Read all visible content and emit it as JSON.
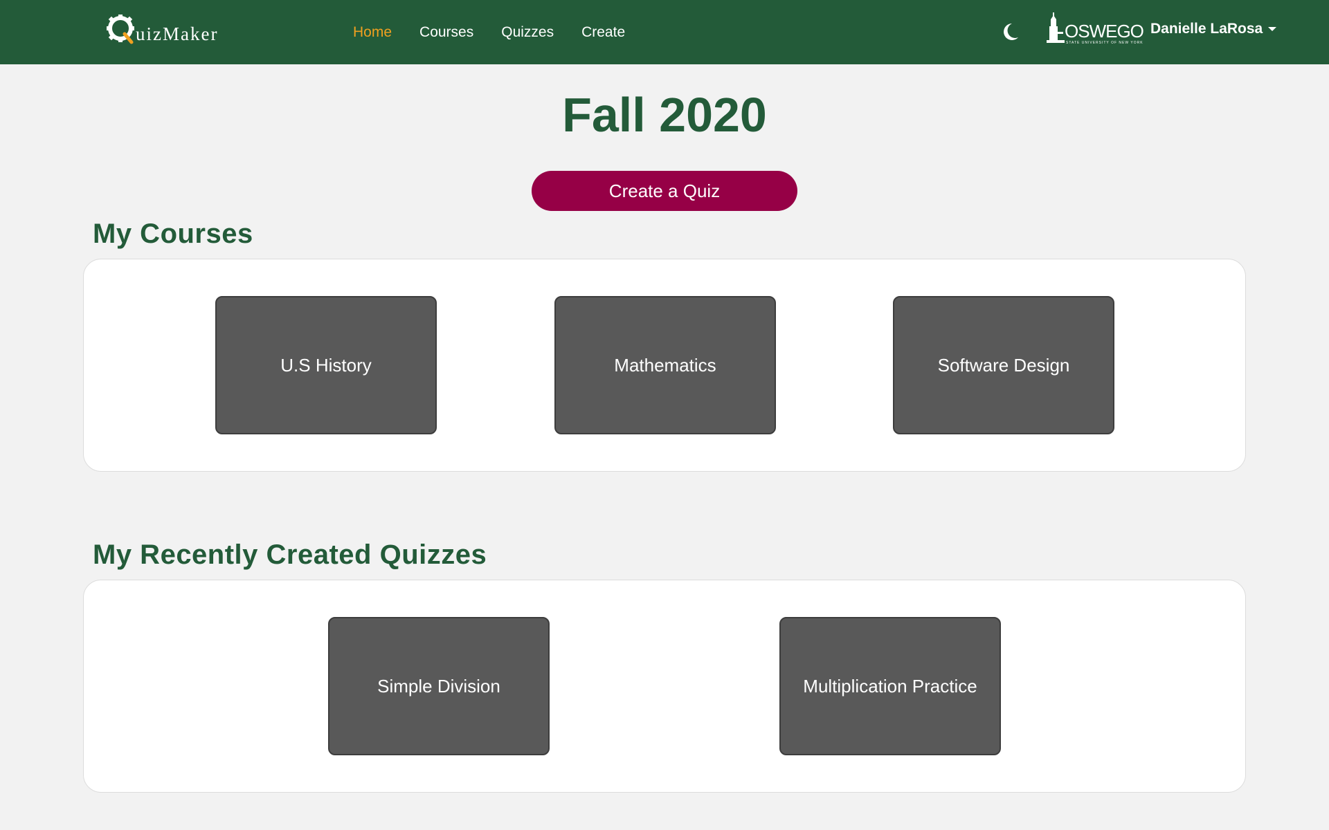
{
  "brand": {
    "logo_text": "uizMaker"
  },
  "nav": {
    "links": [
      "Home",
      "Courses",
      "Quizzes",
      "Create"
    ],
    "active_index": 0
  },
  "header_right": {
    "theme_icon": "moon-icon",
    "university_logo": {
      "text": "OSWEGO",
      "subtext": "STATE UNIVERSITY OF NEW YORK"
    },
    "user_name": "Danielle LaRosa"
  },
  "page": {
    "title": "Fall 2020",
    "create_button_label": "Create a Quiz"
  },
  "courses": {
    "title": "My Courses",
    "items": [
      "U.S History",
      "Mathematics",
      "Software Design"
    ]
  },
  "quizzes": {
    "title": "My Recently Created Quizzes",
    "items": [
      "Simple Division",
      "Multiplication Practice"
    ]
  },
  "colors": {
    "nav_bg": "#235b39",
    "accent_active": "#f0a020",
    "heading": "#235b39",
    "button": "#960046",
    "tile": "#595959",
    "background": "#f2f2f2"
  }
}
